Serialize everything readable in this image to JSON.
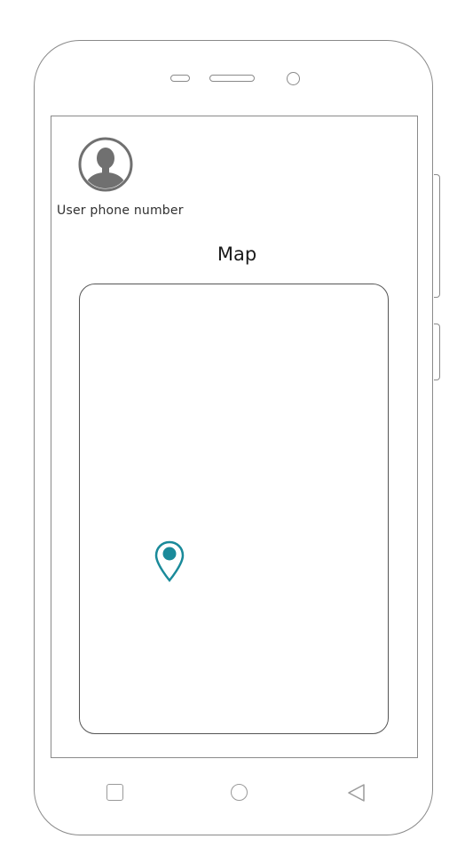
{
  "profile": {
    "avatar_icon": "user-avatar-icon",
    "phone_label": "User phone number"
  },
  "map": {
    "title": "Map",
    "pin_icon": "location-pin-icon",
    "pin_color": "#1a8a9a"
  },
  "nav_bar": {
    "recents_icon": "square-recents-icon",
    "home_icon": "circle-home-icon",
    "back_icon": "triangle-back-icon"
  },
  "colors": {
    "outline": "#8a8a8a",
    "avatar": "#707070",
    "accent": "#1a8a9a"
  }
}
